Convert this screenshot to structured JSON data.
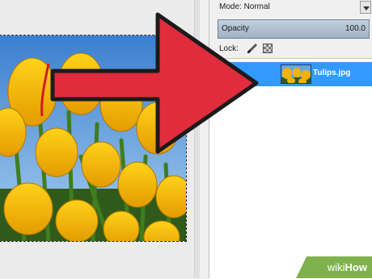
{
  "layers_panel": {
    "mode_label": "Mode: Normal",
    "opacity_label": "Opacity",
    "opacity_value": "100.0",
    "lock_label": "Lock:",
    "layers": [
      {
        "name": "Tulips.jpg",
        "selected": true
      }
    ]
  },
  "icons": {
    "lock_pixels": "paintbrush-icon",
    "lock_alpha": "checkerboard-icon",
    "mode_dropdown": "chevron-down-icon"
  },
  "colors": {
    "selection": "#3399ff",
    "arrow": "#e02c3c",
    "watermark": "#7fb24c"
  },
  "watermark": {
    "wiki": "wiki",
    "how": "How"
  }
}
